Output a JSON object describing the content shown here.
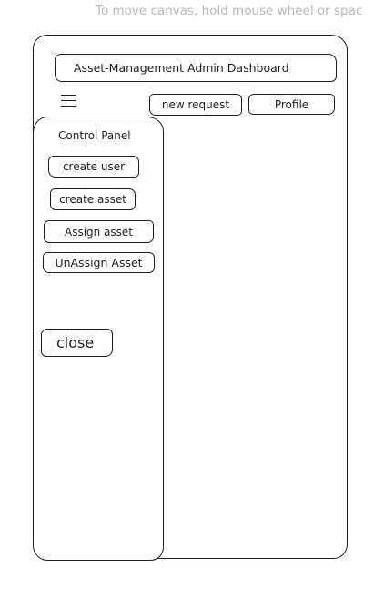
{
  "canvas_hint": "To move canvas, hold mouse wheel or spac",
  "header": {
    "title": "Asset-Management Admin Dashboard",
    "menu_icon": "hamburger-icon",
    "new_request_label": "new request",
    "profile_label": "Profile"
  },
  "control_panel": {
    "title": "Control Panel",
    "create_user_label": "create user",
    "create_asset_label": "create asset",
    "assign_asset_label": "Assign asset",
    "unassign_asset_label": "UnAssign Asset",
    "close_label": "close"
  }
}
